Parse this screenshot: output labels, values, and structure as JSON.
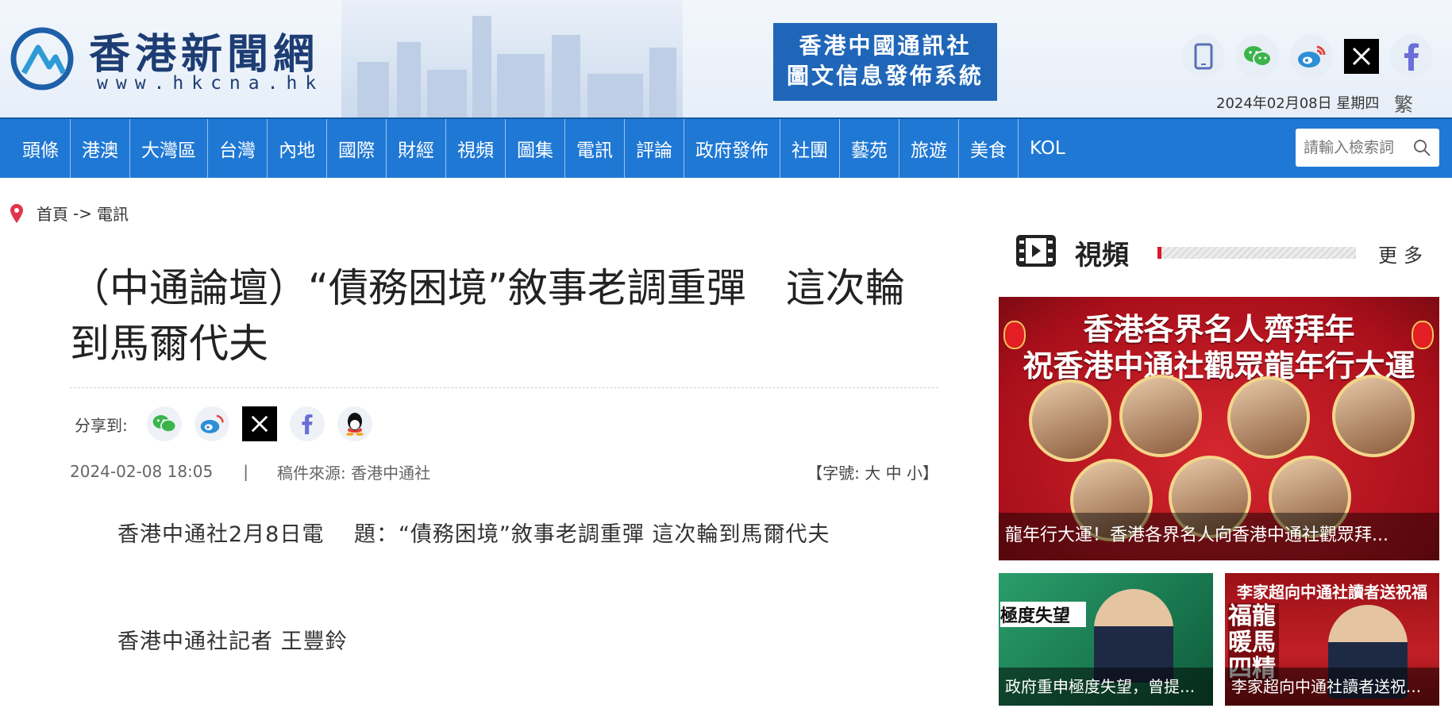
{
  "header": {
    "logo_name": "香港新聞網",
    "logo_url": "www.hkcna.hk",
    "agency_line1": "香港中國通訊社",
    "agency_line2": "圖文信息發佈系統",
    "date": "2024年02月08日 星期四",
    "lang_switch": "繁 简",
    "social_icons": [
      "mobile-icon",
      "wechat-icon",
      "weibo-icon",
      "x-icon",
      "facebook-icon"
    ]
  },
  "nav": {
    "items": [
      "頭條",
      "港澳",
      "大灣區",
      "台灣",
      "內地",
      "國際",
      "財經",
      "視頻",
      "圖集",
      "電訊",
      "評論",
      "政府發佈",
      "社團",
      "藝苑",
      "旅遊",
      "美食",
      "KOL"
    ],
    "search_placeholder": "請輸入檢索詞"
  },
  "breadcrumb": {
    "home": "首頁",
    "separator": "->",
    "current": "電訊"
  },
  "article": {
    "title": "（中通論壇）“債務困境”敘事老調重彈　這次輪到馬爾代夫",
    "share_label": "分享到:",
    "share_icons": [
      "wechat-icon",
      "weibo-icon",
      "x-icon",
      "facebook-icon",
      "qq-icon"
    ],
    "datetime": "2024-02-08 18:05",
    "divider": "|",
    "source": "稿件來源: 香港中通社",
    "font_size_control": "【字號: 大 中 小】",
    "paragraphs": [
      "香港中通社2月8日電　 題：“債務困境”敘事老調重彈 這次輪到馬爾代夫",
      "香港中通社記者 王豐鈴"
    ]
  },
  "sidebar": {
    "section_title": "視頻",
    "more_label": "更多",
    "feature": {
      "headline_line1": "香港各界名人齊拜年",
      "headline_line2": "祝香港中通社觀眾龍年行大運",
      "caption": "龍年行大運！香港各界名人向香港中通社觀眾拜..."
    },
    "thumbs": [
      {
        "overlay_text": "極度失望",
        "caption": "政府重申極度失望，曾提..."
      },
      {
        "overlay_text": "李家超向中通社讀者送祝福",
        "side_text": "福龍暖馬四精",
        "caption": "李家超向中通社讀者送祝..."
      }
    ]
  },
  "colors": {
    "nav_blue": "#1f78d4",
    "agency_blue": "#1f66b8",
    "logo_navy": "#1d3d74",
    "accent_red": "#d8192a"
  }
}
